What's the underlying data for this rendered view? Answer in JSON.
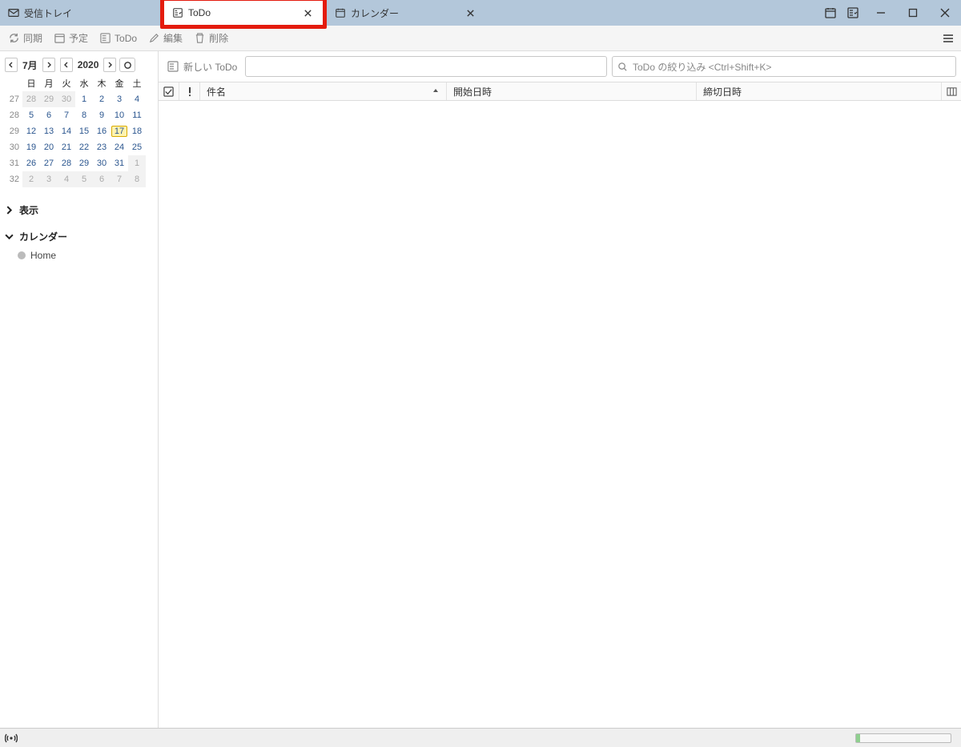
{
  "tabs": {
    "inbox": {
      "label": "受信トレイ"
    },
    "todo": {
      "label": "ToDo"
    },
    "calendar": {
      "label": "カレンダー"
    }
  },
  "toolbar": {
    "sync": "同期",
    "event": "予定",
    "todo": "ToDo",
    "edit": "編集",
    "delete": "削除"
  },
  "miniCal": {
    "monthLabel": "7月",
    "yearLabel": "2020",
    "dow": [
      "日",
      "月",
      "火",
      "水",
      "木",
      "金",
      "土"
    ],
    "weeks": [
      {
        "wk": "27",
        "days": [
          {
            "d": "28",
            "other": true
          },
          {
            "d": "29",
            "other": true
          },
          {
            "d": "30",
            "other": true
          },
          {
            "d": "1"
          },
          {
            "d": "2"
          },
          {
            "d": "3"
          },
          {
            "d": "4"
          }
        ]
      },
      {
        "wk": "28",
        "days": [
          {
            "d": "5"
          },
          {
            "d": "6"
          },
          {
            "d": "7"
          },
          {
            "d": "8"
          },
          {
            "d": "9"
          },
          {
            "d": "10"
          },
          {
            "d": "11"
          }
        ]
      },
      {
        "wk": "29",
        "days": [
          {
            "d": "12"
          },
          {
            "d": "13"
          },
          {
            "d": "14"
          },
          {
            "d": "15"
          },
          {
            "d": "16"
          },
          {
            "d": "17",
            "today": true
          },
          {
            "d": "18"
          }
        ]
      },
      {
        "wk": "30",
        "days": [
          {
            "d": "19"
          },
          {
            "d": "20"
          },
          {
            "d": "21"
          },
          {
            "d": "22"
          },
          {
            "d": "23"
          },
          {
            "d": "24"
          },
          {
            "d": "25"
          }
        ]
      },
      {
        "wk": "31",
        "days": [
          {
            "d": "26"
          },
          {
            "d": "27"
          },
          {
            "d": "28"
          },
          {
            "d": "29"
          },
          {
            "d": "30"
          },
          {
            "d": "31"
          },
          {
            "d": "1",
            "other": true
          }
        ]
      },
      {
        "wk": "32",
        "days": [
          {
            "d": "2",
            "other": true
          },
          {
            "d": "3",
            "other": true
          },
          {
            "d": "4",
            "other": true
          },
          {
            "d": "5",
            "other": true
          },
          {
            "d": "6",
            "other": true
          },
          {
            "d": "7",
            "other": true
          },
          {
            "d": "8",
            "other": true
          }
        ]
      }
    ]
  },
  "sidebar": {
    "viewLabel": "表示",
    "calendarLabel": "カレンダー",
    "calendars": [
      {
        "name": "Home"
      }
    ]
  },
  "content": {
    "newTodoLabel": "新しい ToDo",
    "filterPlaceholder": "ToDo の絞り込み  <Ctrl+Shift+K>",
    "columns": {
      "subject": "件名",
      "start": "開始日時",
      "due": "締切日時"
    }
  }
}
